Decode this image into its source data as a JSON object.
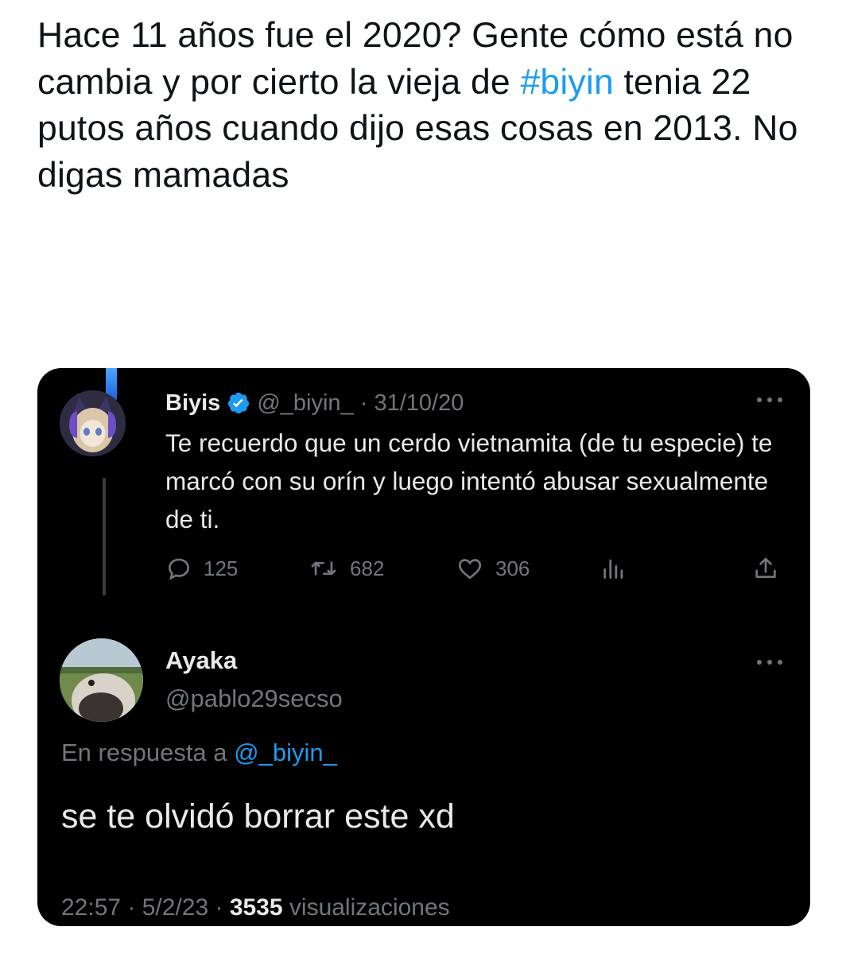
{
  "caption": {
    "before": "Hace 11 años fue el 2020? Gente cómo está no cambia y por cierto la vieja de ",
    "hashtag": "#biyin",
    "after": " tenia 22 putos años cuando dijo esas cosas en 2013. No digas mamadas"
  },
  "quoted_tweet": {
    "name": "Biyis",
    "handle_date": "@_biyin_ · 31/10/20",
    "text": "Te recuerdo que un cerdo vietnamita (de tu especie) te marcó con su orín y luego intentó abusar sexualmente de ti.",
    "replies": "125",
    "retweets": "682",
    "likes": "306"
  },
  "reply_tweet": {
    "name": "Ayaka",
    "handle": "@pablo29secso",
    "reply_to_label": "En respuesta a ",
    "reply_to_mention": "@_biyin_",
    "text": "se te olvidó borrar este xd",
    "time": "22:57 · 5/2/23 · ",
    "views": "3535",
    "views_label": " visualizaciones"
  },
  "colors": {
    "accent": "#1d9bf0",
    "muted": "#71767b",
    "text_dark": "#e7e9ea",
    "background_dark": "#000000"
  },
  "icons": [
    "verified-icon",
    "more-icon",
    "reply-icon",
    "retweet-icon",
    "like-icon",
    "analytics-icon",
    "share-icon"
  ]
}
